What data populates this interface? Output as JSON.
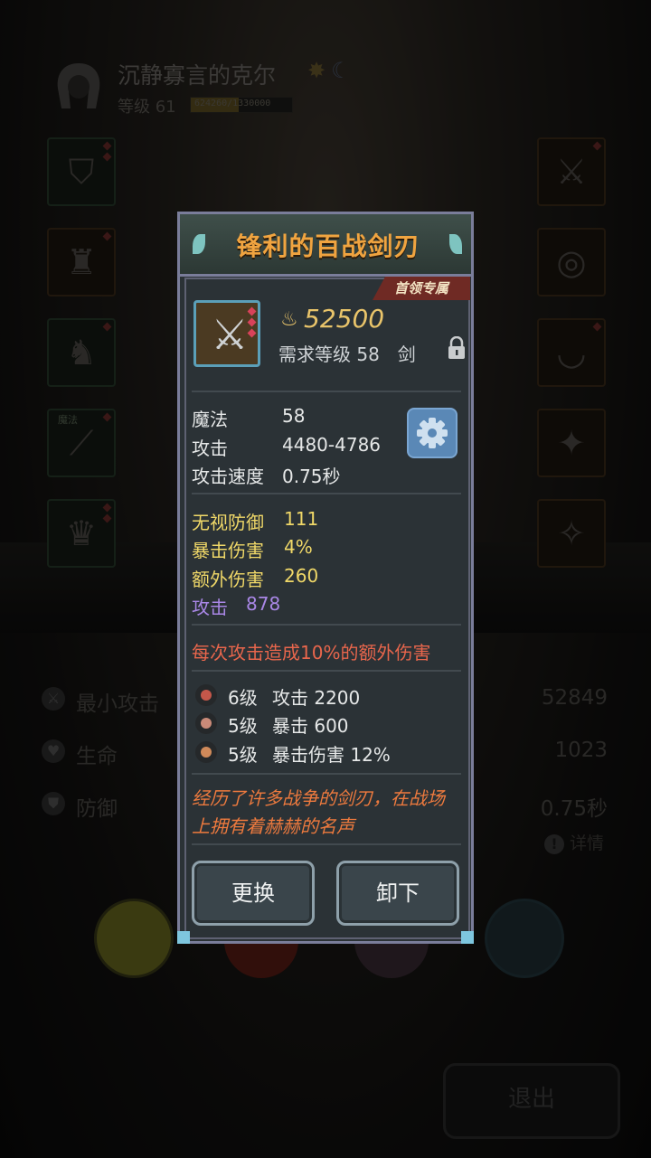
{
  "header": {
    "player_name": "沉静寡言的克尔",
    "level_text": "等级 61",
    "exp_text": "624260/1330000",
    "exp_fraction": 0.47,
    "title_icons": [
      "sun-badge-icon",
      "moon-badge-icon"
    ]
  },
  "slots_left": [
    {
      "icon": "armor-icon",
      "tag": ""
    },
    {
      "icon": "coat-icon",
      "tag": ""
    },
    {
      "icon": "boots-icon",
      "tag": ""
    },
    {
      "icon": "bracer-icon",
      "tag": "魔法"
    },
    {
      "icon": "cloak-icon",
      "tag": ""
    }
  ],
  "slots_right": [
    {
      "icon": "sword-icon"
    },
    {
      "icon": "ring-icon"
    },
    {
      "icon": "necklace-icon"
    },
    {
      "icon": "trinket-icon"
    },
    {
      "icon": "amulet-icon"
    }
  ],
  "stats": [
    {
      "label": "最小攻击",
      "value": "52849"
    },
    {
      "label": "生命",
      "value": "1023"
    },
    {
      "label": "防御",
      "value": "0.75秒"
    }
  ],
  "details_label": "详情",
  "exit_label": "退出",
  "item": {
    "name": "锋利的百战剑刃",
    "badge": "首领专属",
    "price": "52500",
    "requirement": "需求等级 58　剑",
    "base_stats": [
      {
        "label": "魔法",
        "value": "58"
      },
      {
        "label": "攻击",
        "value": "4480-4786"
      },
      {
        "label": "攻击速度",
        "value": "0.75秒"
      }
    ],
    "bonus_stats": [
      {
        "label": "无视防御",
        "value": "111",
        "color": "#f0d868"
      },
      {
        "label": "暴击伤害",
        "value": "4%",
        "color": "#f0d868"
      },
      {
        "label": "额外伤害",
        "value": "260",
        "color": "#f0d868"
      },
      {
        "label": "攻击",
        "value": "878",
        "color": "#a987e6"
      }
    ],
    "special": "每次攻击造成10%的额外伤害",
    "gems": [
      {
        "level": "6级",
        "effect": "攻击 2200",
        "color": "#c4574a"
      },
      {
        "level": "5级",
        "effect": "暴击 600",
        "color": "#c98a78"
      },
      {
        "level": "5级",
        "effect": "暴击伤害 12%",
        "color": "#d08a5a"
      }
    ],
    "description": "经历了许多战争的剑刃，在战场上拥有着赫赫的名声",
    "replace_label": "更换",
    "unequip_label": "卸下"
  }
}
